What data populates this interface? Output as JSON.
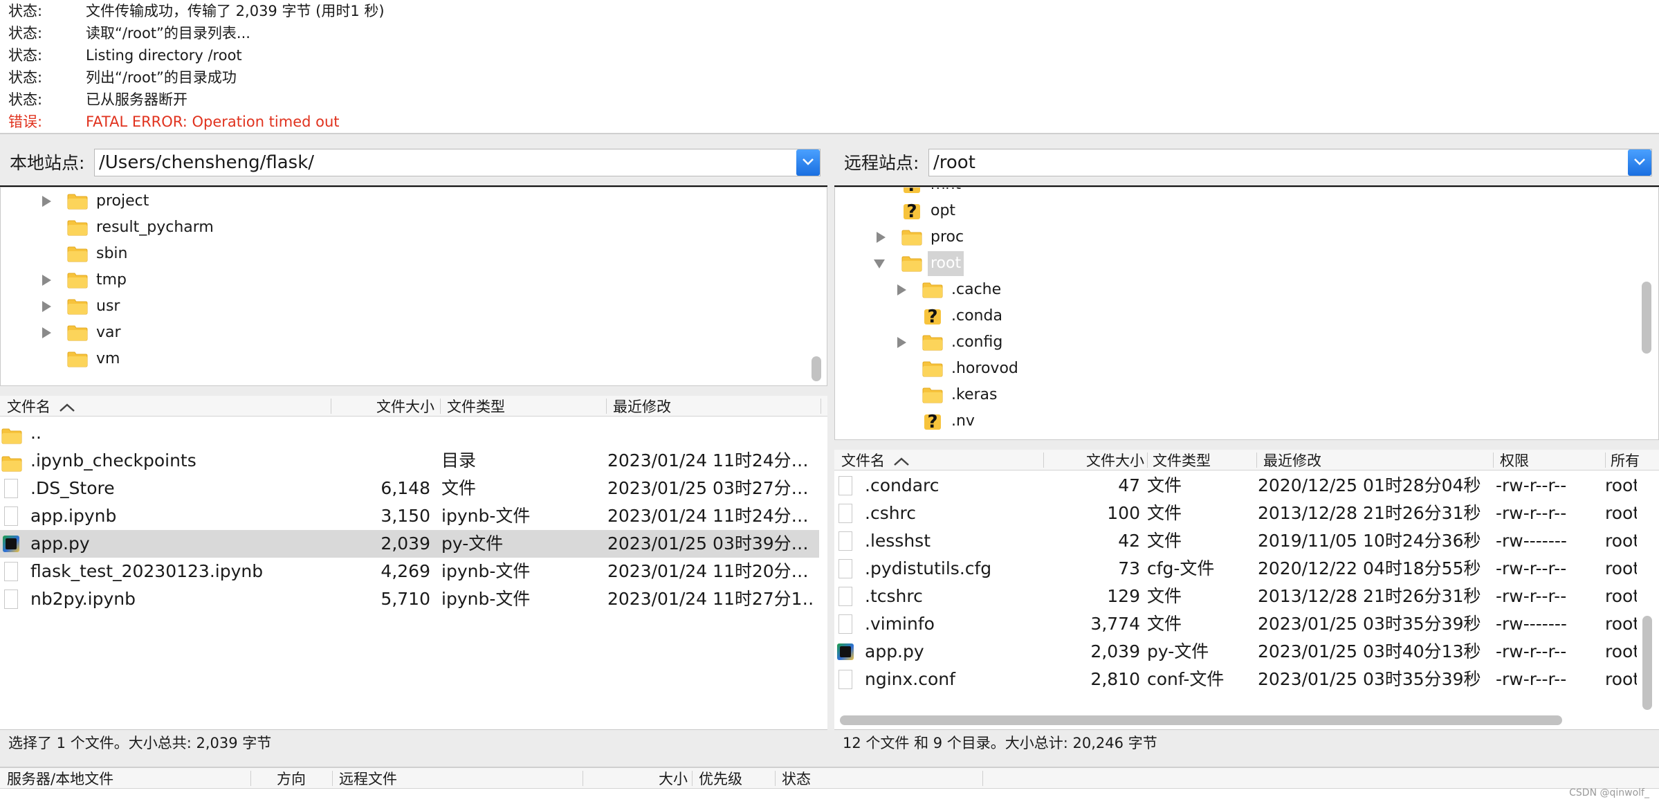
{
  "log": [
    {
      "label": "状态:",
      "text": "文件传输成功，传输了 2,039 字节 (用时1 秒)",
      "error": false
    },
    {
      "label": "状态:",
      "text": "读取“/root”的目录列表...",
      "error": false
    },
    {
      "label": "状态:",
      "text": "Listing directory /root",
      "error": false
    },
    {
      "label": "状态:",
      "text": "列出“/root”的目录成功",
      "error": false
    },
    {
      "label": "状态:",
      "text": "已从服务器断开",
      "error": false
    },
    {
      "label": "错误:",
      "text": "FATAL ERROR: Operation timed out",
      "error": true
    }
  ],
  "local": {
    "site_label": "本地站点:",
    "path": "/Users/chensheng/flask/",
    "tree": [
      {
        "name": "project",
        "arrow": "right"
      },
      {
        "name": "result_pycharm",
        "arrow": "none"
      },
      {
        "name": "sbin",
        "arrow": "none"
      },
      {
        "name": "tmp",
        "arrow": "right"
      },
      {
        "name": "usr",
        "arrow": "right"
      },
      {
        "name": "var",
        "arrow": "right"
      },
      {
        "name": "vm",
        "arrow": "none"
      }
    ],
    "columns": {
      "name": "文件名",
      "size": "文件大小",
      "type": "文件类型",
      "modified": "最近修改"
    },
    "files": [
      {
        "name": "..",
        "size": "",
        "type": "",
        "modified": "",
        "icon": "folder"
      },
      {
        "name": ".ipynb_checkpoints",
        "size": "",
        "type": "目录",
        "modified": "2023/01/24 11时24分…",
        "icon": "folder"
      },
      {
        "name": ".DS_Store",
        "size": "6,148",
        "type": "文件",
        "modified": "2023/01/25 03时27分…",
        "icon": "doc"
      },
      {
        "name": "app.ipynb",
        "size": "3,150",
        "type": "ipynb-文件",
        "modified": "2023/01/24 11时24分…",
        "icon": "doc"
      },
      {
        "name": "app.py",
        "size": "2,039",
        "type": "py-文件",
        "modified": "2023/01/25 03时39分…",
        "icon": "py",
        "selected": true
      },
      {
        "name": "flask_test_20230123.ipynb",
        "size": "4,269",
        "type": "ipynb-文件",
        "modified": "2023/01/24 11时20分…",
        "icon": "doc"
      },
      {
        "name": "nb2py.ipynb",
        "size": "5,710",
        "type": "ipynb-文件",
        "modified": "2023/01/24 11时27分1…",
        "icon": "doc"
      }
    ],
    "status": "选择了 1 个文件。大小总共: 2,039 字节"
  },
  "remote": {
    "site_label": "远程站点:",
    "path": "/root",
    "tree": [
      {
        "name": "mnt",
        "arrow": "none",
        "icon": "question",
        "depth": 0
      },
      {
        "name": "opt",
        "arrow": "none",
        "icon": "question",
        "depth": 0
      },
      {
        "name": "proc",
        "arrow": "right",
        "icon": "folder",
        "depth": 0
      },
      {
        "name": "root",
        "arrow": "down",
        "icon": "folder",
        "depth": 0,
        "selected": true
      },
      {
        "name": ".cache",
        "arrow": "right",
        "icon": "folder",
        "depth": 1
      },
      {
        "name": ".conda",
        "arrow": "none",
        "icon": "question",
        "depth": 1
      },
      {
        "name": ".config",
        "arrow": "right",
        "icon": "folder",
        "depth": 1
      },
      {
        "name": ".horovod",
        "arrow": "none",
        "icon": "folder",
        "depth": 1
      },
      {
        "name": ".keras",
        "arrow": "none",
        "icon": "folder",
        "depth": 1
      },
      {
        "name": ".nv",
        "arrow": "none",
        "icon": "question",
        "depth": 1
      }
    ],
    "columns": {
      "name": "文件名",
      "size": "文件大小",
      "type": "文件类型",
      "modified": "最近修改",
      "perm": "权限",
      "owner": "所有"
    },
    "files": [
      {
        "name": ".condarc",
        "size": "47",
        "type": "文件",
        "modified": "2020/12/25 01时28分04秒",
        "perm": "-rw-r--r--",
        "owner": "root",
        "icon": "doc"
      },
      {
        "name": ".cshrc",
        "size": "100",
        "type": "文件",
        "modified": "2013/12/28 21时26分31秒",
        "perm": "-rw-r--r--",
        "owner": "root",
        "icon": "doc"
      },
      {
        "name": ".lesshst",
        "size": "42",
        "type": "文件",
        "modified": "2019/11/05 10时24分36秒",
        "perm": "-rw-------",
        "owner": "root",
        "icon": "doc"
      },
      {
        "name": ".pydistutils.cfg",
        "size": "73",
        "type": "cfg-文件",
        "modified": "2020/12/22 04时18分55秒",
        "perm": "-rw-r--r--",
        "owner": "root",
        "icon": "doc"
      },
      {
        "name": ".tcshrc",
        "size": "129",
        "type": "文件",
        "modified": "2013/12/28 21时26分31秒",
        "perm": "-rw-r--r--",
        "owner": "root",
        "icon": "doc"
      },
      {
        "name": ".viminfo",
        "size": "3,774",
        "type": "文件",
        "modified": "2023/01/25 03时35分39秒",
        "perm": "-rw-------",
        "owner": "root",
        "icon": "doc"
      },
      {
        "name": "app.py",
        "size": "2,039",
        "type": "py-文件",
        "modified": "2023/01/25 03时40分13秒",
        "perm": "-rw-r--r--",
        "owner": "root",
        "icon": "py"
      },
      {
        "name": "nginx.conf",
        "size": "2,810",
        "type": "conf-文件",
        "modified": "2023/01/25 03时35分39秒",
        "perm": "-rw-r--r--",
        "owner": "root",
        "icon": "doc"
      }
    ],
    "status": "12 个文件 和 9 个目录。大小总计: 20,246 字节"
  },
  "queue": {
    "c1": "服务器/本地文件",
    "c2": "方向",
    "c3": "远程文件",
    "c4": "大小",
    "c5": "优先级",
    "c6": "状态"
  },
  "watermark": "CSDN @qinwolf_",
  "colors": {
    "error": "#e0321e",
    "dropdown": "#2a7de8",
    "folder": "#f8c840",
    "selection": "#d9d9d9"
  }
}
